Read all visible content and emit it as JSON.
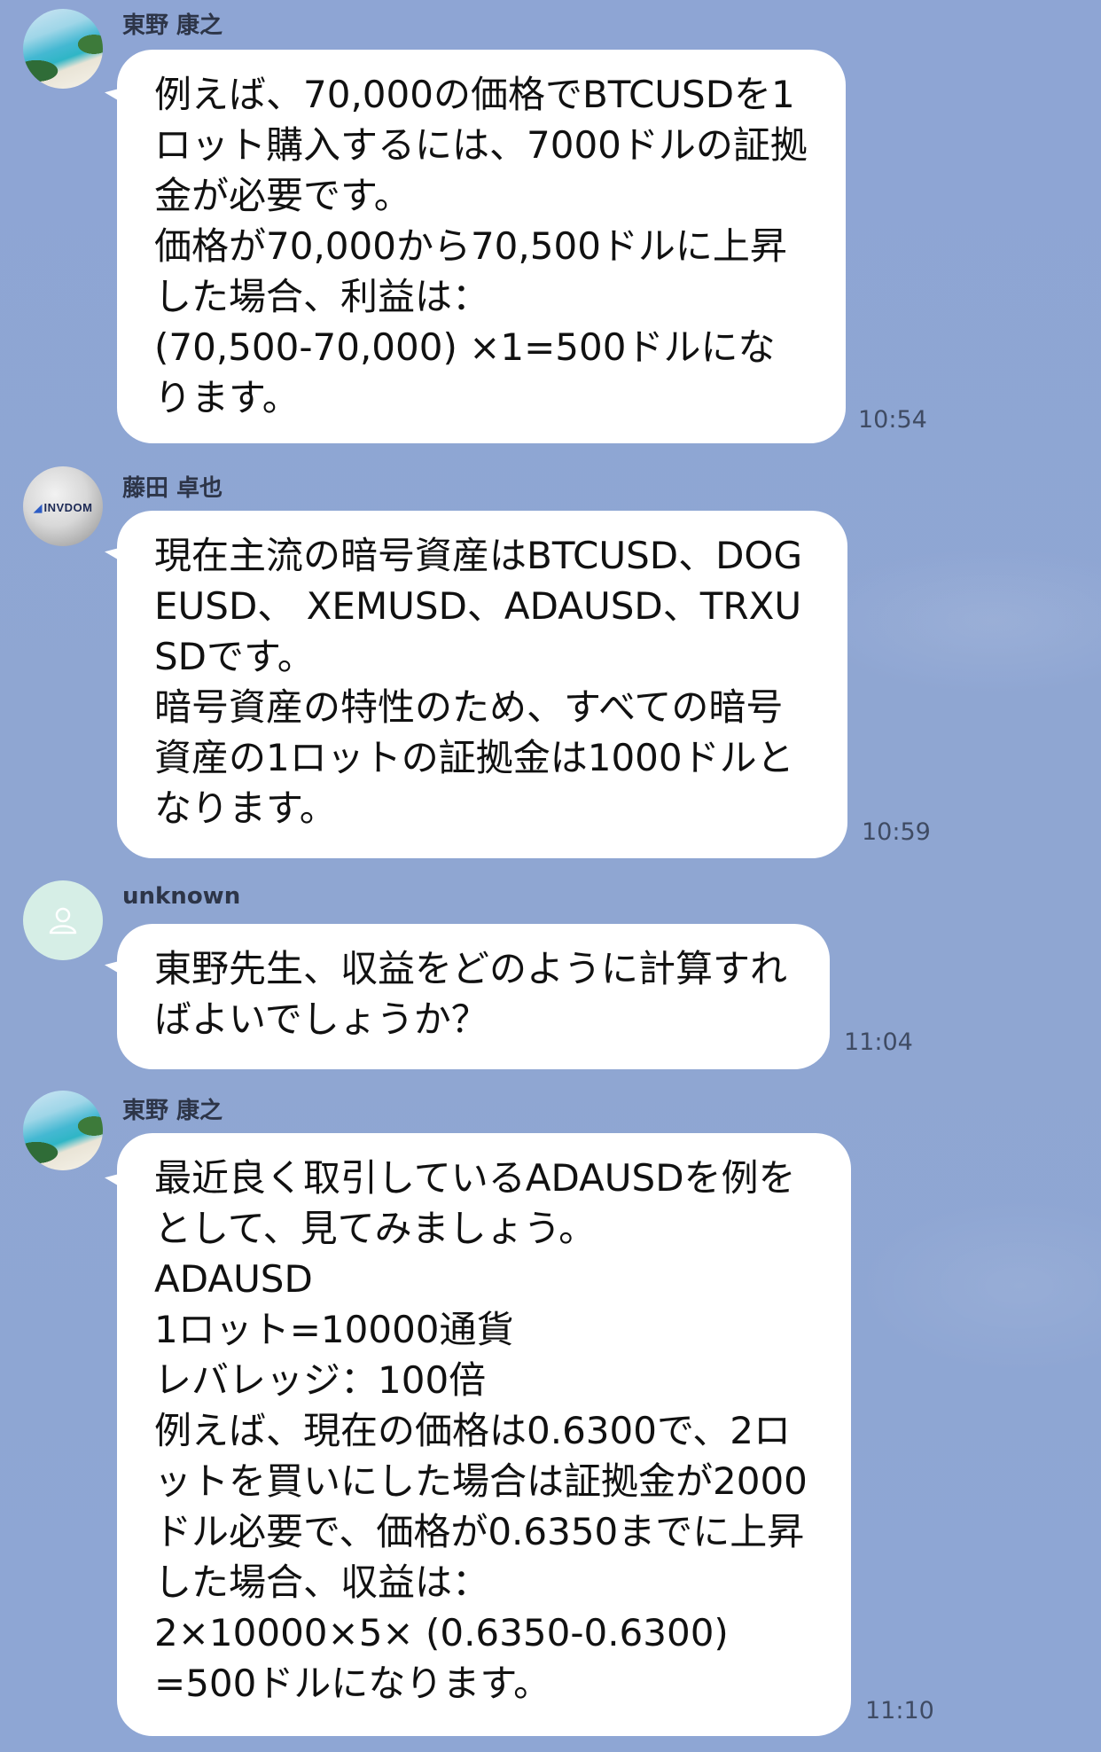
{
  "messages": [
    {
      "sender": "東野 康之",
      "avatar": "beach-photo-avatar",
      "text": "例えば、70,000の価格でBTCUSDを1ロット購入するには、7000ドルの証拠金が必要です。\n価格が70,000から70,500ドルに上昇した場合、利益は：\n(70,500-70,000) ×1=500ドルになります。",
      "time": "10:54"
    },
    {
      "sender": "藤田 卓也",
      "avatar": "invdom-logo-avatar",
      "avatar_text": "INVDOM",
      "text": "現在主流の暗号資産はBTCUSD、DOGEUSD、 XEMUSD、ADAUSD、TRXUSDです。\n暗号資産の特性のため、すべての暗号資産の1ロットの証拠金は1000ドルとなります。",
      "time": "10:59"
    },
    {
      "sender": "unknown",
      "avatar": "default-user-avatar",
      "text": "東野先生、収益をどのように計算すればよいでしょうか？",
      "time": "11:04"
    },
    {
      "sender": "東野 康之",
      "avatar": "beach-photo-avatar",
      "text": "最近良く取引しているADAUSDを例をとして、見てみましょう。\nADAUSD\n1ロット=10000通貨\nレバレッジ：100倍\n例えば、現在の価格は0.6300で、2ロットを買いにした場合は証拠金が2000ドル必要で、価格が0.6350までに上昇した場合、収益は：\n2×10000×5× (0.6350-0.6300)\n=500ドルになります。",
      "time": "11:10"
    }
  ],
  "colors": {
    "background": "#8fa6d3",
    "bubble": "#ffffff",
    "name_text": "#2d3548",
    "time_text": "#3f4b63"
  }
}
